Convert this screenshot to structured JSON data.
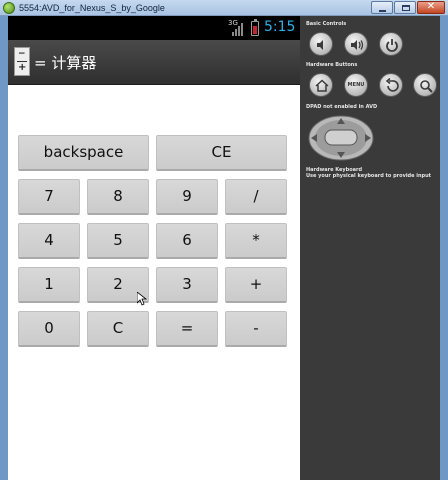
{
  "window": {
    "title": "5554:AVD_for_Nexus_S_by_Google",
    "controls": [
      "minimize",
      "maximize",
      "close"
    ]
  },
  "status_bar": {
    "network": "3G",
    "time": "5:15",
    "battery_color": "#c0262c",
    "time_color": "#2fb0e8"
  },
  "app": {
    "title_suffix": "= 计算器",
    "icon_top": "−",
    "icon_bottom": "+",
    "buttons": [
      {
        "id": "backspace",
        "label": "backspace"
      },
      {
        "id": "ce",
        "label": "CE"
      },
      {
        "id": "7",
        "label": "7"
      },
      {
        "id": "8",
        "label": "8"
      },
      {
        "id": "9",
        "label": "9"
      },
      {
        "id": "div",
        "label": "/"
      },
      {
        "id": "4",
        "label": "4"
      },
      {
        "id": "5",
        "label": "5"
      },
      {
        "id": "6",
        "label": "6"
      },
      {
        "id": "mul",
        "label": "*"
      },
      {
        "id": "1",
        "label": "1"
      },
      {
        "id": "2",
        "label": "2"
      },
      {
        "id": "3",
        "label": "3"
      },
      {
        "id": "plus",
        "label": "+"
      },
      {
        "id": "0",
        "label": "0"
      },
      {
        "id": "c",
        "label": "C"
      },
      {
        "id": "eq",
        "label": "="
      },
      {
        "id": "minus",
        "label": "-"
      }
    ]
  },
  "panel": {
    "basic_controls_label": "Basic Controls",
    "hardware_buttons_label": "Hardware Buttons",
    "dpad_label": "DPAD not enabled in AVD",
    "keyboard_label": "Hardware Keyboard",
    "keyboard_hint": "Use your physical keyboard to provide input",
    "menu_label": "MENU",
    "basic_controls": [
      "volume-down-icon",
      "volume-up-icon",
      "power-icon"
    ],
    "hardware_buttons": [
      "home-icon",
      "menu-button",
      "back-icon",
      "search-icon"
    ]
  }
}
